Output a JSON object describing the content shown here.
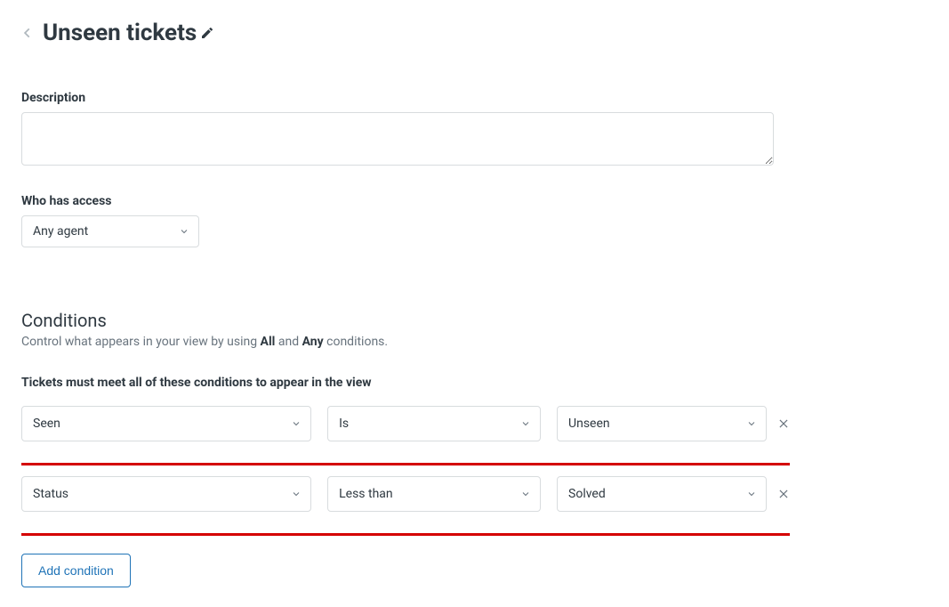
{
  "header": {
    "title": "Unseen tickets"
  },
  "description": {
    "label": "Description",
    "value": ""
  },
  "access": {
    "label": "Who has access",
    "selected": "Any agent"
  },
  "conditions": {
    "heading": "Conditions",
    "subtext_prefix": "Control what appears in your view by using ",
    "subtext_all": "All",
    "subtext_mid": " and ",
    "subtext_any": "Any",
    "subtext_suffix": " conditions.",
    "all_label": "Tickets must meet all of these conditions to appear in the view",
    "rows": [
      {
        "field": "Seen",
        "operator": "Is",
        "value": "Unseen"
      },
      {
        "field": "Status",
        "operator": "Less than",
        "value": "Solved"
      }
    ],
    "add_button": "Add condition"
  }
}
